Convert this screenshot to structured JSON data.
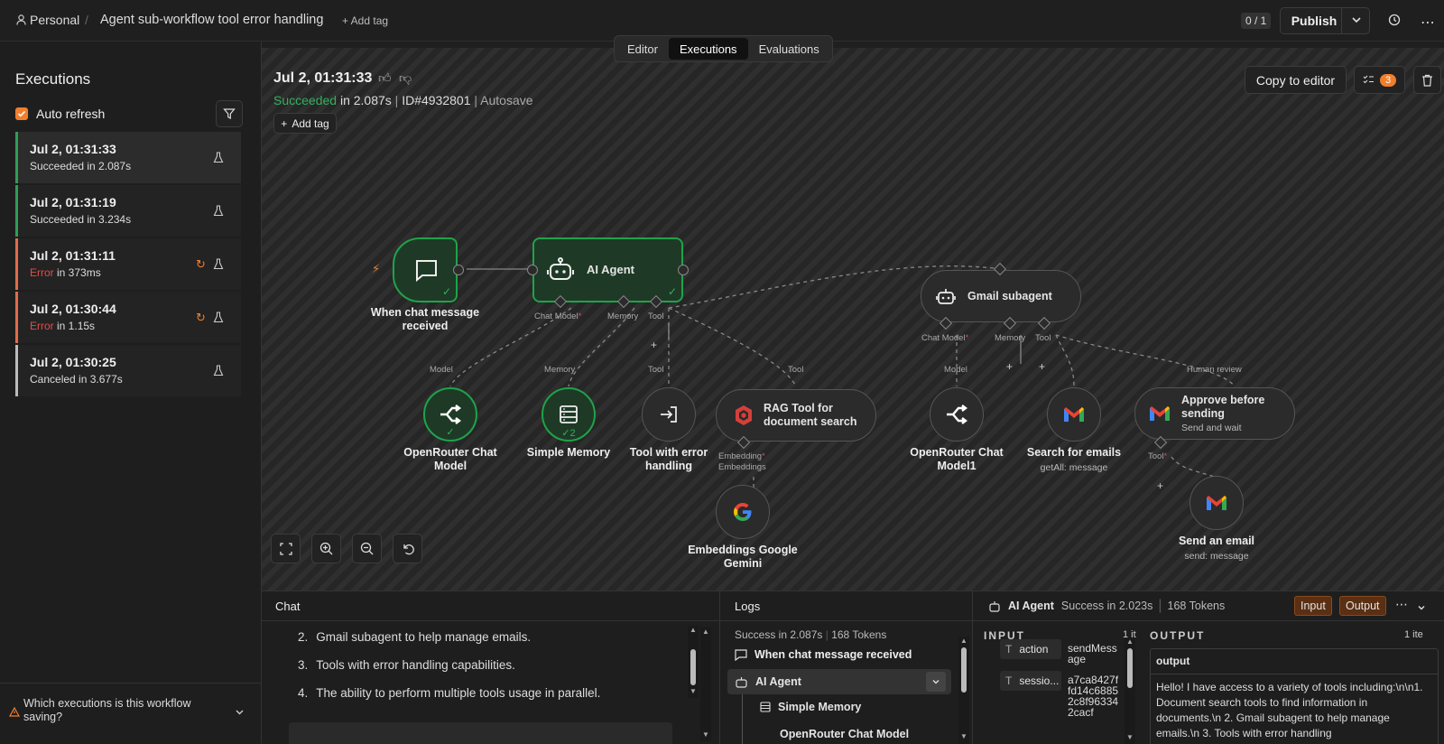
{
  "header": {
    "project": "Personal",
    "workflow_title": "Agent sub-workflow tool error handling",
    "add_tag": "+ Add tag",
    "counter": "0 / 1",
    "publish": "Publish"
  },
  "tabs": [
    "Editor",
    "Executions",
    "Evaluations"
  ],
  "sidebar": {
    "title": "Executions",
    "auto_refresh": "Auto refresh",
    "items": [
      {
        "time": "Jul 2, 01:31:33",
        "status": "Succeeded",
        "rest": " in 2.087s",
        "kind": "success"
      },
      {
        "time": "Jul 2, 01:31:19",
        "status": "Succeeded",
        "rest": " in 3.234s",
        "kind": "success"
      },
      {
        "time": "Jul 2, 01:31:11",
        "status": "Error",
        "rest": " in 373ms",
        "kind": "error"
      },
      {
        "time": "Jul 2, 01:30:44",
        "status": "Error",
        "rest": " in 1.15s",
        "kind": "error"
      },
      {
        "time": "Jul 2, 01:30:25",
        "status": "Canceled",
        "rest": " in 3.677s",
        "kind": "canceled"
      }
    ],
    "footer": "Which executions is this workflow saving?"
  },
  "execution": {
    "time": "Jul 2, 01:31:33",
    "status": "Succeeded",
    "duration": " in 2.087s",
    "id": "ID#4932801",
    "autosave": "Autosave",
    "add_tag": "Add tag",
    "copy_to_editor": "Copy to editor",
    "badge": "3"
  },
  "nodes": {
    "trigger": "When chat message received",
    "agent": "AI Agent",
    "gmail_subagent": "Gmail subagent",
    "openrouter": "OpenRouter Chat Model",
    "memory": "Simple Memory",
    "memory_count": "2",
    "tool_error": "Tool with error handling",
    "rag": "RAG Tool for document search",
    "embeddings": "Embeddings Google Gemini",
    "openrouter1": "OpenRouter Chat Model1",
    "search_emails": "Search for emails",
    "search_emails_sub": "getAll: message",
    "approve": "Approve before sending",
    "approve_sub": "Send and wait",
    "send_email": "Send an email",
    "send_email_sub": "send: message"
  },
  "ports": {
    "chat_model": "Chat Model",
    "memory": "Memory",
    "tool": "Tool",
    "model": "Model",
    "embedding": "Embedding",
    "embeddings": "Embeddings",
    "human_review": "Human review"
  },
  "chat": {
    "title": "Chat",
    "lines": [
      {
        "num": "2.",
        "text": "Gmail subagent to help manage emails."
      },
      {
        "num": "3.",
        "text": "Tools with error handling capabilities."
      },
      {
        "num": "4.",
        "text": "The ability to perform multiple tools usage in parallel."
      }
    ]
  },
  "logs": {
    "title": "Logs",
    "summary": "Success in 2.087s",
    "tokens": "168 Tokens",
    "items": [
      "When chat message received",
      "AI Agent",
      "Simple Memory",
      "OpenRouter Chat Model"
    ]
  },
  "detail": {
    "node": "AI Agent",
    "status": "Success in 2.023s",
    "tokens": "168 Tokens",
    "input_btn": "Input",
    "output_btn": "Output",
    "input_label": "INPUT",
    "input_count": "1 it",
    "output_label": "OUTPUT",
    "output_count": "1 ite",
    "input_rows": [
      {
        "key": "action",
        "value": "sendMessage"
      },
      {
        "key": "sessio...",
        "value": "a7ca8427ffd14c68852c8f963342cacf"
      }
    ],
    "output_key": "output",
    "output_text": "Hello! I have access to a variety of tools including:\\n\\n1. Document search tools to find information in documents.\\n 2. Gmail subagent to help manage emails.\\n 3. Tools with error handling"
  }
}
